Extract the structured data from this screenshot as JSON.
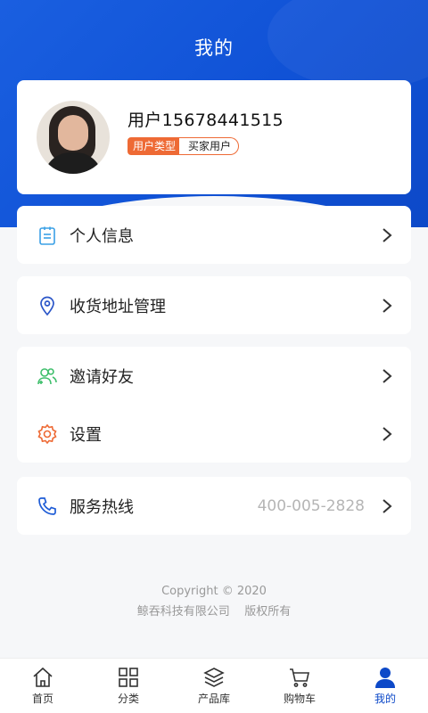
{
  "header": {
    "title": "我的"
  },
  "profile": {
    "username": "用户15678441515",
    "type_label": "用户类型",
    "type_value": "买家用户"
  },
  "menu": {
    "personal_info": "个人信息",
    "address": "收货地址管理",
    "invite": "邀请好友",
    "settings": "设置",
    "hotline_label": "服务热线",
    "hotline_number": "400-005-2828"
  },
  "footer": {
    "copyright": "Copyright ©  2020",
    "company": "鲸吞科技有限公司    版权所有"
  },
  "tabs": [
    {
      "label": "首页",
      "icon": "home-icon"
    },
    {
      "label": "分类",
      "icon": "category-icon"
    },
    {
      "label": "产品库",
      "icon": "layers-icon"
    },
    {
      "label": "购物车",
      "icon": "cart-icon"
    },
    {
      "label": "我的",
      "icon": "user-icon"
    }
  ],
  "colors": {
    "primary": "#1052d6",
    "tag_orange": "#ee6a35",
    "address_icon": "#2a55c8",
    "invite_icon": "#3fbf6c",
    "settings_icon": "#ee6a35",
    "hotline_icon": "#1e5cd6",
    "info_icon": "#3aa0e6"
  }
}
